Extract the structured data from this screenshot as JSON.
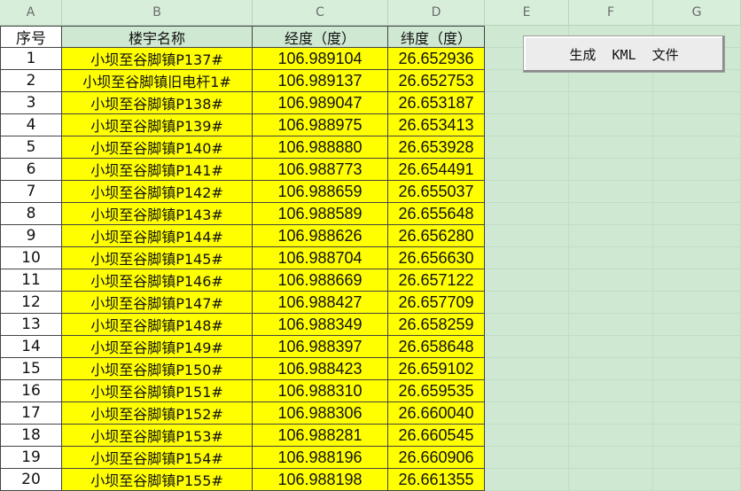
{
  "columns": [
    "A",
    "B",
    "C",
    "D",
    "E",
    "F",
    "G"
  ],
  "table": {
    "headers": [
      "序号",
      "楼宇名称",
      "经度（度）",
      "纬度（度）"
    ],
    "rows": [
      [
        "1",
        "小坝至谷脚镇P137#",
        "106.989104",
        "26.652936"
      ],
      [
        "2",
        "小坝至谷脚镇旧电杆1#",
        "106.989137",
        "26.652753"
      ],
      [
        "3",
        "小坝至谷脚镇P138#",
        "106.989047",
        "26.653187"
      ],
      [
        "4",
        "小坝至谷脚镇P139#",
        "106.988975",
        "26.653413"
      ],
      [
        "5",
        "小坝至谷脚镇P140#",
        "106.988880",
        "26.653928"
      ],
      [
        "6",
        "小坝至谷脚镇P141#",
        "106.988773",
        "26.654491"
      ],
      [
        "7",
        "小坝至谷脚镇P142#",
        "106.988659",
        "26.655037"
      ],
      [
        "8",
        "小坝至谷脚镇P143#",
        "106.988589",
        "26.655648"
      ],
      [
        "9",
        "小坝至谷脚镇P144#",
        "106.988626",
        "26.656280"
      ],
      [
        "10",
        "小坝至谷脚镇P145#",
        "106.988704",
        "26.656630"
      ],
      [
        "11",
        "小坝至谷脚镇P146#",
        "106.988669",
        "26.657122"
      ],
      [
        "12",
        "小坝至谷脚镇P147#",
        "106.988427",
        "26.657709"
      ],
      [
        "13",
        "小坝至谷脚镇P148#",
        "106.988349",
        "26.658259"
      ],
      [
        "14",
        "小坝至谷脚镇P149#",
        "106.988397",
        "26.658648"
      ],
      [
        "15",
        "小坝至谷脚镇P150#",
        "106.988423",
        "26.659102"
      ],
      [
        "16",
        "小坝至谷脚镇P151#",
        "106.988310",
        "26.659535"
      ],
      [
        "17",
        "小坝至谷脚镇P152#",
        "106.988306",
        "26.660040"
      ],
      [
        "18",
        "小坝至谷脚镇P153#",
        "106.988281",
        "26.660545"
      ],
      [
        "19",
        "小坝至谷脚镇P154#",
        "106.988196",
        "26.660906"
      ],
      [
        "20",
        "小坝至谷脚镇P155#",
        "106.988198",
        "26.661355"
      ]
    ]
  },
  "button": {
    "label": "生成  KML  文件"
  },
  "colors": {
    "highlight": "#ffff00",
    "sheet_background": "#cfe8d2"
  }
}
